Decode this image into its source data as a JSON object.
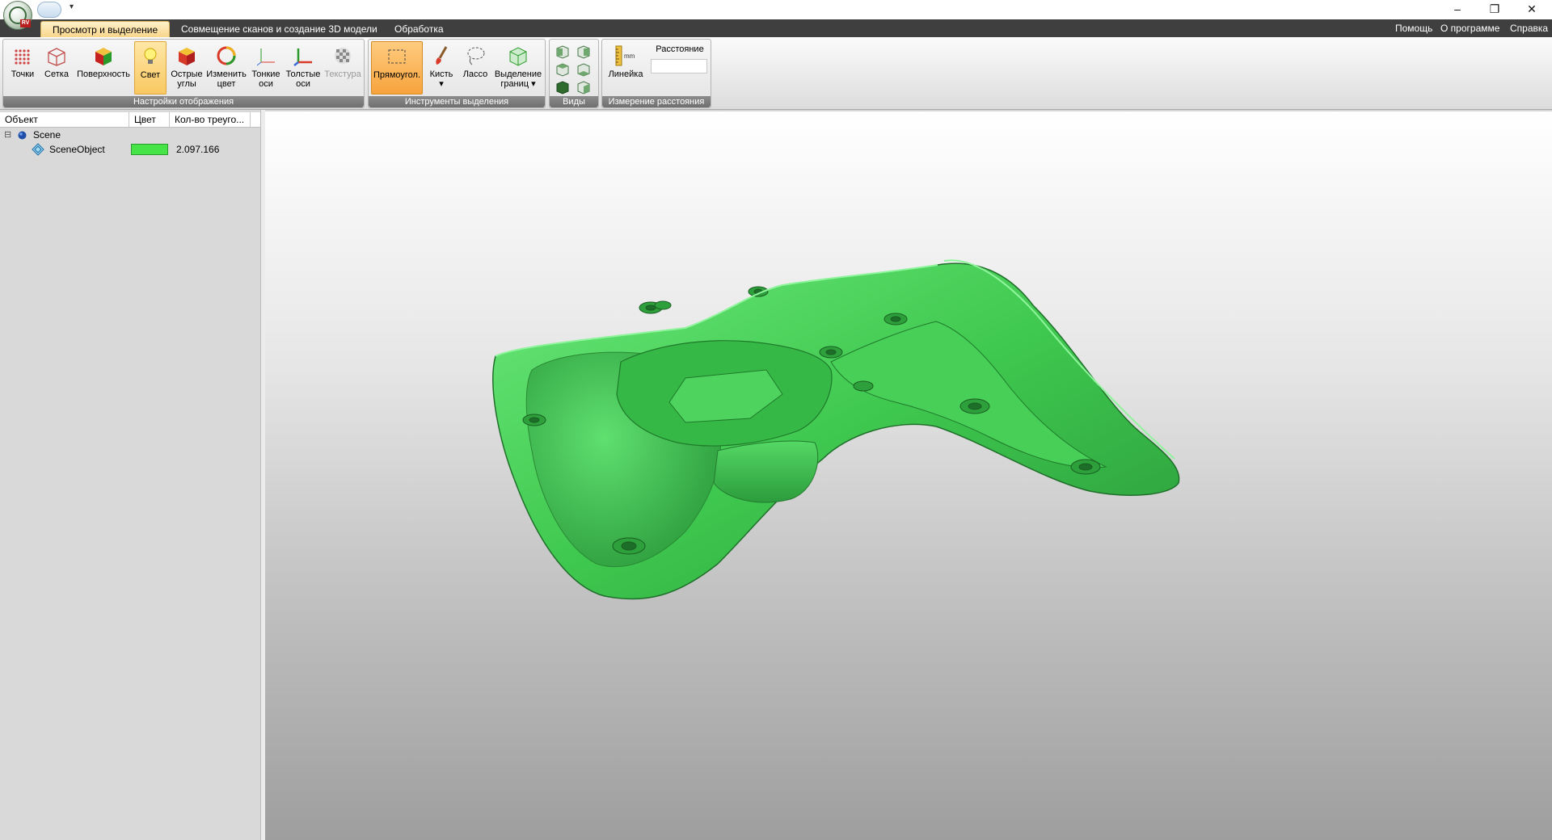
{
  "titlebar": {
    "app_badge": "RV",
    "qat_dropdown": "▾",
    "window_buttons": {
      "minimize": "–",
      "restore": "❐",
      "close": "✕"
    }
  },
  "tabs": [
    {
      "label": "Просмотр и выделение",
      "active": true
    },
    {
      "label": "Совмещение сканов и создание 3D модели",
      "active": false
    },
    {
      "label": "Обработка",
      "active": false
    }
  ],
  "right_links": {
    "help": "Помощь",
    "about": "О программе",
    "reference": "Справка"
  },
  "ribbon": {
    "display": {
      "label": "Настройки отображения",
      "points": "Точки",
      "mesh": "Сетка",
      "surface": "Поверхность",
      "light": "Свет",
      "sharp_1": "Острые",
      "sharp_2": "углы",
      "color_1": "Изменить",
      "color_2": "цвет",
      "thin_1": "Тонкие",
      "thin_2": "оси",
      "thick_1": "Толстые",
      "thick_2": "оси",
      "texture": "Текстура"
    },
    "selection": {
      "label": "Инструменты выделения",
      "rect": "Прямоугол.",
      "brush": "Кисть",
      "lasso": "Лассо",
      "border_1": "Выделение",
      "border_2": "границ",
      "arrow": "▾"
    },
    "views": {
      "label": "Виды"
    },
    "measure": {
      "label": "Измерение расстояния",
      "ruler": "Линейка",
      "ruler_unit": "mm",
      "distance_title": "Расстояние",
      "distance_value": ""
    }
  },
  "tree": {
    "headers": {
      "object": "Объект",
      "color": "Цвет",
      "triangles": "Кол-во треуго..."
    },
    "expander": "⊟",
    "rows": [
      {
        "name": "Scene",
        "color": "",
        "count": ""
      },
      {
        "name": "SceneObject",
        "color": "#46e446",
        "count": "2.097.166"
      }
    ]
  },
  "colors": {
    "model_green": "#3fc84f",
    "active_tab": "#f8d68c",
    "pressed_button": "#f9c862"
  }
}
